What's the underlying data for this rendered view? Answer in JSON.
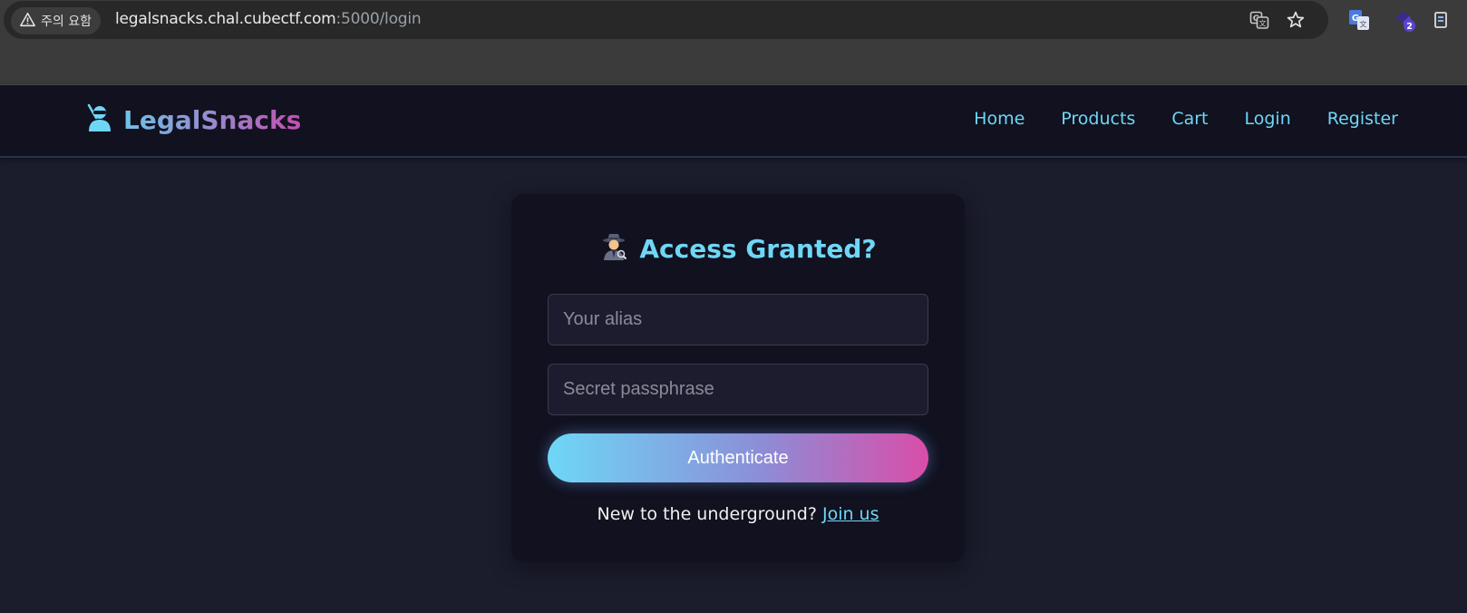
{
  "browser": {
    "security_chip": "주의 요함",
    "url_host": "legalsnacks.chal.cubectf.com",
    "url_rest": ":5000/login",
    "icons": [
      "warning-icon",
      "translate-icon",
      "star-icon",
      "google-translate-extension-icon",
      "extension-icon",
      "side-panel-icon"
    ],
    "extension_badge": "2"
  },
  "site": {
    "brand": "LegalSnacks",
    "nav": [
      "Home",
      "Products",
      "Cart",
      "Login",
      "Register"
    ]
  },
  "login": {
    "title": "Access Granted?",
    "alias_placeholder": "Your alias",
    "passphrase_placeholder": "Secret passphrase",
    "submit_label": "Authenticate",
    "footer_text": "New to the underground? ",
    "footer_link": "Join us"
  },
  "colors": {
    "accent_cyan": "#6ed7f6",
    "accent_pink": "#d94da8",
    "background": "#1b1c2c",
    "card": "#11111f"
  }
}
